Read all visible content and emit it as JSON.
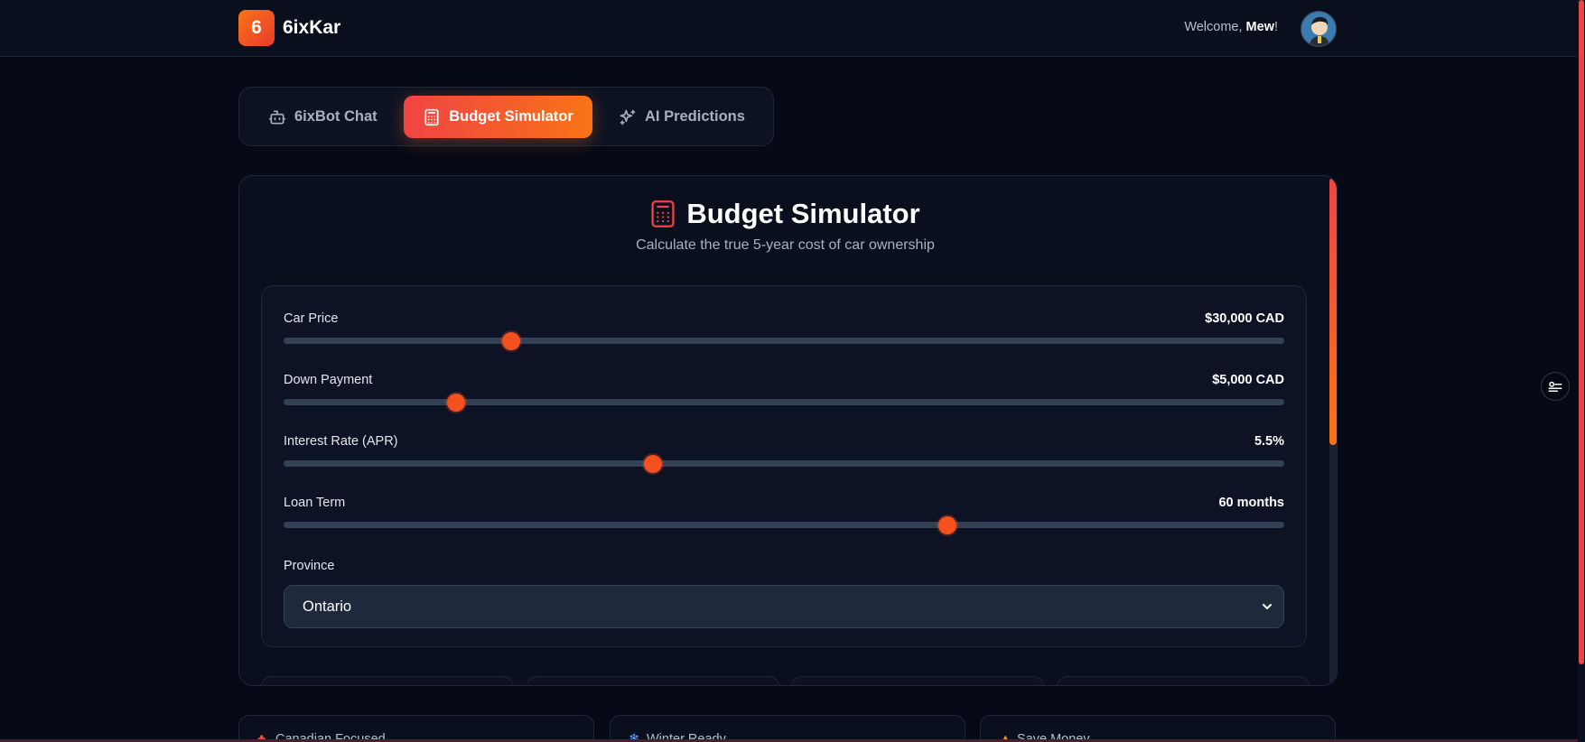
{
  "header": {
    "logo_badge": "6",
    "brand_name": "6ixKar",
    "welcome_prefix": "Welcome, ",
    "user_name": "Mew",
    "welcome_suffix": "!"
  },
  "tabs": [
    {
      "label": "6ixBot Chat",
      "icon": "bot-icon",
      "active": false
    },
    {
      "label": "Budget Simulator",
      "icon": "calculator-icon",
      "active": true
    },
    {
      "label": "AI Predictions",
      "icon": "sparkles-icon",
      "active": false
    }
  ],
  "simulator": {
    "title": "Budget Simulator",
    "subtitle": "Calculate the true 5-year cost of car ownership",
    "sliders": [
      {
        "label": "Car Price",
        "value": "$30,000 CAD",
        "position": 0.227
      },
      {
        "label": "Down Payment",
        "value": "$5,000 CAD",
        "position": 0.172
      },
      {
        "label": "Interest Rate (APR)",
        "value": "5.5%",
        "position": 0.369
      },
      {
        "label": "Loan Term",
        "value": "60 months",
        "position": 0.663
      }
    ],
    "province": {
      "label": "Province",
      "selected": "Ontario"
    }
  },
  "features": [
    {
      "label": "Canadian Focused",
      "icon": "maple-leaf-icon"
    },
    {
      "label": "Winter Ready",
      "icon": "snowflake-icon"
    },
    {
      "label": "Save Money",
      "icon": "money-bag-icon"
    }
  ],
  "colors": {
    "accent_start": "#ef4444",
    "accent_end": "#f97316",
    "background": "#060a16",
    "knob": "#f4511e"
  }
}
